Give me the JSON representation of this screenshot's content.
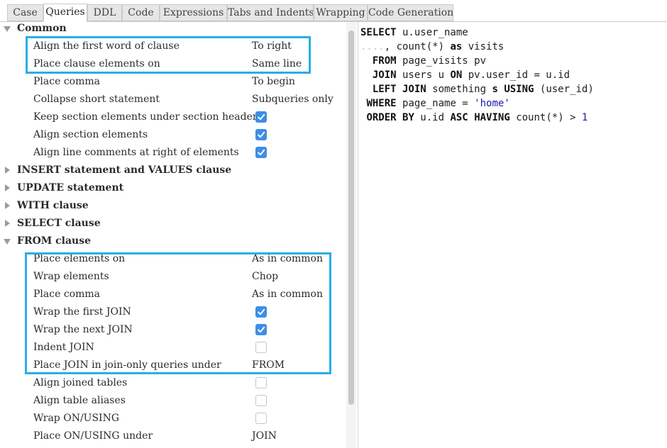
{
  "tabs": [
    {
      "label": "Case"
    },
    {
      "label": "Queries",
      "selected": true
    },
    {
      "label": "DDL"
    },
    {
      "label": "Code"
    },
    {
      "label": "Expressions"
    },
    {
      "label": "Tabs and Indents"
    },
    {
      "label": "Wrapping"
    },
    {
      "label": "Code Generation"
    }
  ],
  "tree": {
    "common": {
      "label": "Common",
      "rows": [
        {
          "label": "Align the first word of clause",
          "value": "To right"
        },
        {
          "label": "Place clause elements on",
          "value": "Same line"
        },
        {
          "label": "Place comma",
          "value": "To begin"
        },
        {
          "label": "Collapse short statement",
          "value": "Subqueries only"
        },
        {
          "label": "Keep section elements under section header",
          "checked": true
        },
        {
          "label": "Align section elements",
          "checked": true
        },
        {
          "label": "Align line comments at right of elements",
          "checked": true
        }
      ]
    },
    "collapsed_groups": [
      {
        "label": "INSERT statement and VALUES clause"
      },
      {
        "label": "UPDATE statement"
      },
      {
        "label": "WITH clause"
      },
      {
        "label": "SELECT clause"
      }
    ],
    "from_clause": {
      "label": "FROM clause",
      "rows": [
        {
          "label": "Place elements on",
          "value": "As in common"
        },
        {
          "label": "Wrap elements",
          "value": "Chop"
        },
        {
          "label": "Place comma",
          "value": "As in common"
        },
        {
          "label": "Wrap the first JOIN",
          "checked": true
        },
        {
          "label": "Wrap the next JOIN",
          "checked": true
        },
        {
          "label": "Indent JOIN",
          "checked": false
        },
        {
          "label": "Place JOIN in join-only queries under",
          "value": "FROM"
        },
        {
          "label": "Align joined tables",
          "checked": false
        },
        {
          "label": "Align table aliases",
          "checked": false
        },
        {
          "label": "Wrap ON/USING",
          "checked": false
        },
        {
          "label": "Place ON/USING under",
          "value": "JOIN"
        }
      ]
    }
  },
  "preview": {
    "lines": [
      [
        {
          "t": "SELECT",
          "k": 1
        },
        {
          "t": " u.user_name"
        }
      ],
      [
        {
          "t": "....",
          "d": 1
        },
        {
          "t": ", count(*) "
        },
        {
          "t": "as",
          "k": 1
        },
        {
          "t": " visits"
        }
      ],
      [
        {
          "t": "  "
        },
        {
          "t": "FROM",
          "k": 1
        },
        {
          "t": " page_visits pv"
        }
      ],
      [
        {
          "t": "  "
        },
        {
          "t": "JOIN",
          "k": 1
        },
        {
          "t": " users u "
        },
        {
          "t": "ON",
          "k": 1
        },
        {
          "t": " pv.user_id = u.id"
        }
      ],
      [
        {
          "t": "  "
        },
        {
          "t": "LEFT JOIN",
          "k": 1
        },
        {
          "t": " something "
        },
        {
          "t": "s",
          "k": 1
        },
        {
          "t": " "
        },
        {
          "t": "USING",
          "k": 1
        },
        {
          "t": " (user_id)"
        }
      ],
      [
        {
          "t": " "
        },
        {
          "t": "WHERE",
          "k": 1
        },
        {
          "t": " page_name = "
        },
        {
          "t": "'home'",
          "s": 1
        }
      ],
      [
        {
          "t": " "
        },
        {
          "t": "ORDER BY",
          "k": 1
        },
        {
          "t": " u.id "
        },
        {
          "t": "ASC",
          "k": 1
        },
        {
          "t": " "
        },
        {
          "t": "HAVING",
          "k": 1
        },
        {
          "t": " count(*) > "
        },
        {
          "t": "1",
          "n": 1
        }
      ]
    ]
  }
}
